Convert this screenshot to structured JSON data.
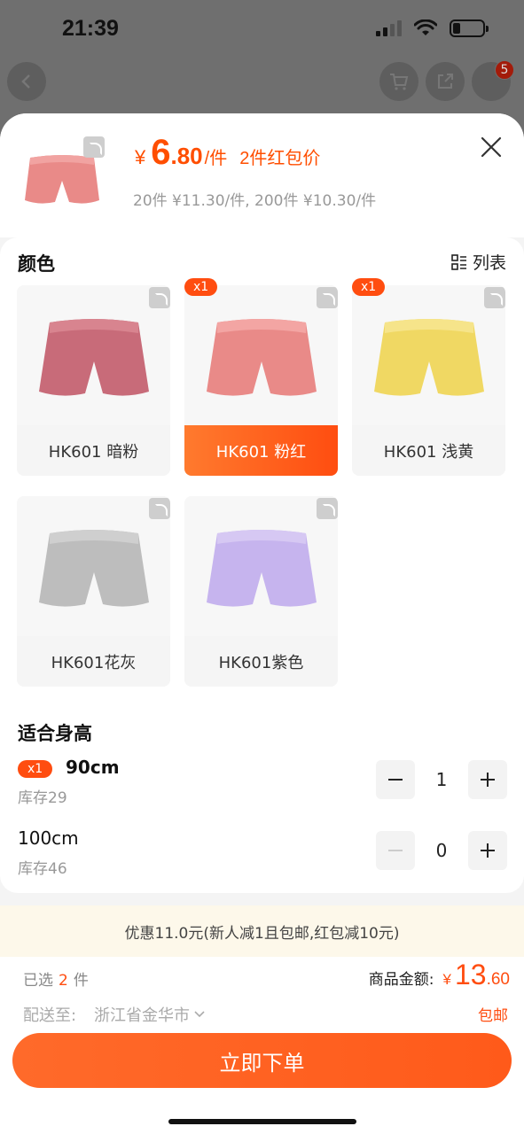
{
  "status": {
    "time": "21:39"
  },
  "nav": {
    "cart_badge": "5"
  },
  "header": {
    "yen": "¥",
    "price_int": "6",
    "price_dec": ".80",
    "unit": "/件",
    "promo_tag": "2件红包价",
    "tiers": "20件 ¥11.30/件, 200件 ¥10.30/件"
  },
  "color_section": {
    "title": "颜色",
    "list_label": "列表",
    "items": [
      {
        "label": "HK601 暗粉",
        "qty": "",
        "color": "#c86b79"
      },
      {
        "label": "HK601 粉红",
        "qty": "x1",
        "color": "#e98a88",
        "selected": true
      },
      {
        "label": "HK601 浅黄",
        "qty": "x1",
        "color": "#f0d863"
      },
      {
        "label": "HK601花灰",
        "qty": "",
        "color": "#bdbdbd"
      },
      {
        "label": "HK601紫色",
        "qty": "",
        "color": "#c6b4ee"
      }
    ]
  },
  "size_section": {
    "title": "适合身高",
    "rows": [
      {
        "badge": "x1",
        "name": "90cm",
        "stock": "库存29",
        "qty": "1"
      },
      {
        "badge": "",
        "name": "100cm",
        "stock": "库存46",
        "qty": "0"
      }
    ]
  },
  "promo": "优惠11.0元(新人减1且包邮,红包减10元)",
  "footer": {
    "selected_prefix": "已选",
    "selected_num": "2",
    "selected_suffix": "件",
    "total_label": "商品金额:",
    "total_yen": "¥",
    "total_int": "13",
    "total_dec": ".60",
    "ship_label": "配送至:",
    "ship_addr": "浙江省金华市",
    "ship_free": "包邮",
    "order_label": "立即下单"
  },
  "colors": {
    "accent": "#ff4d10",
    "promo_bg": "#fdf8ea"
  }
}
